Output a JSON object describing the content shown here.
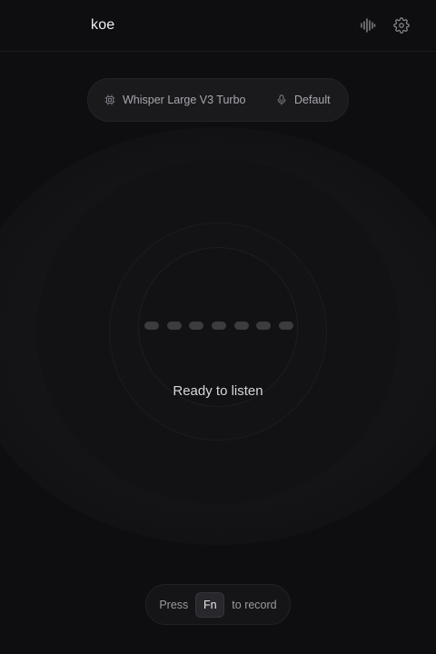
{
  "header": {
    "title": "koe",
    "wave_icon": "waveform-icon",
    "settings_icon": "gear-icon"
  },
  "model_selector": {
    "model_icon": "chip-icon",
    "model_label": "Whisper Large V3 Turbo",
    "mic_icon": "microphone-icon",
    "mic_label": "Default"
  },
  "recorder": {
    "status": "Ready to listen",
    "level_dots": 7
  },
  "hint": {
    "prefix": "Press",
    "key": "Fn",
    "suffix": "to record"
  },
  "colors": {
    "background": "#0e0e10",
    "text": "#e6e6e8",
    "muted": "#a7a7ad"
  }
}
